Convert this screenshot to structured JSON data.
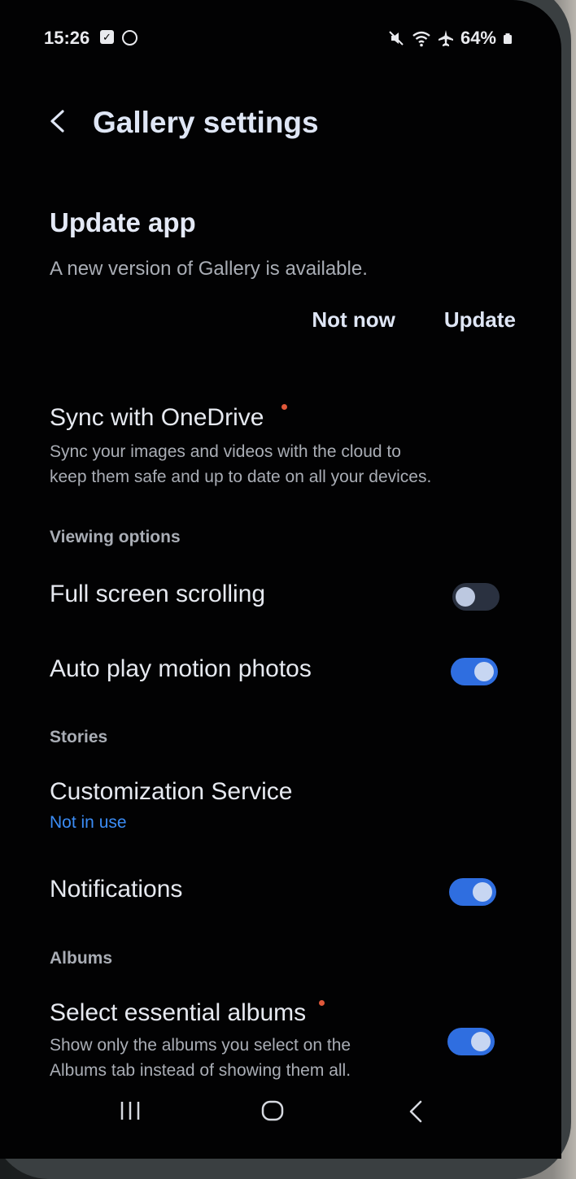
{
  "status_bar": {
    "time": "15:26",
    "battery": "64%",
    "icons": [
      "checkbox-icon",
      "circle-icon",
      "mute-icon",
      "wifi-icon",
      "airplane-icon",
      "battery-icon"
    ]
  },
  "header": {
    "title": "Gallery settings"
  },
  "update_app": {
    "title": "Update app",
    "description": "A new version of Gallery is available.",
    "not_now_label": "Not now",
    "update_label": "Update"
  },
  "onedrive": {
    "title": "Sync with OneDrive",
    "subtitle_line1": "Sync your images and videos with the cloud to",
    "subtitle_line2": "keep them safe and up to date on all your devices."
  },
  "viewing_options": {
    "label": "Viewing options",
    "full_screen_scrolling": {
      "label": "Full screen scrolling",
      "enabled": false
    },
    "auto_play_motion": {
      "label": "Auto play motion photos",
      "enabled": true
    }
  },
  "stories": {
    "label": "Stories",
    "customization": {
      "label": "Customization Service",
      "status": "Not in use"
    },
    "notifications": {
      "label": "Notifications",
      "enabled": true
    }
  },
  "albums": {
    "label": "Albums",
    "essential": {
      "label": "Select essential albums",
      "subtitle_line1": "Show only the albums you select on the",
      "subtitle_line2": "Albums tab instead of showing them all.",
      "enabled": true
    }
  },
  "colors": {
    "accent": "#2f6ee0",
    "link": "#3b8cf5",
    "badge": "#e0583a"
  }
}
